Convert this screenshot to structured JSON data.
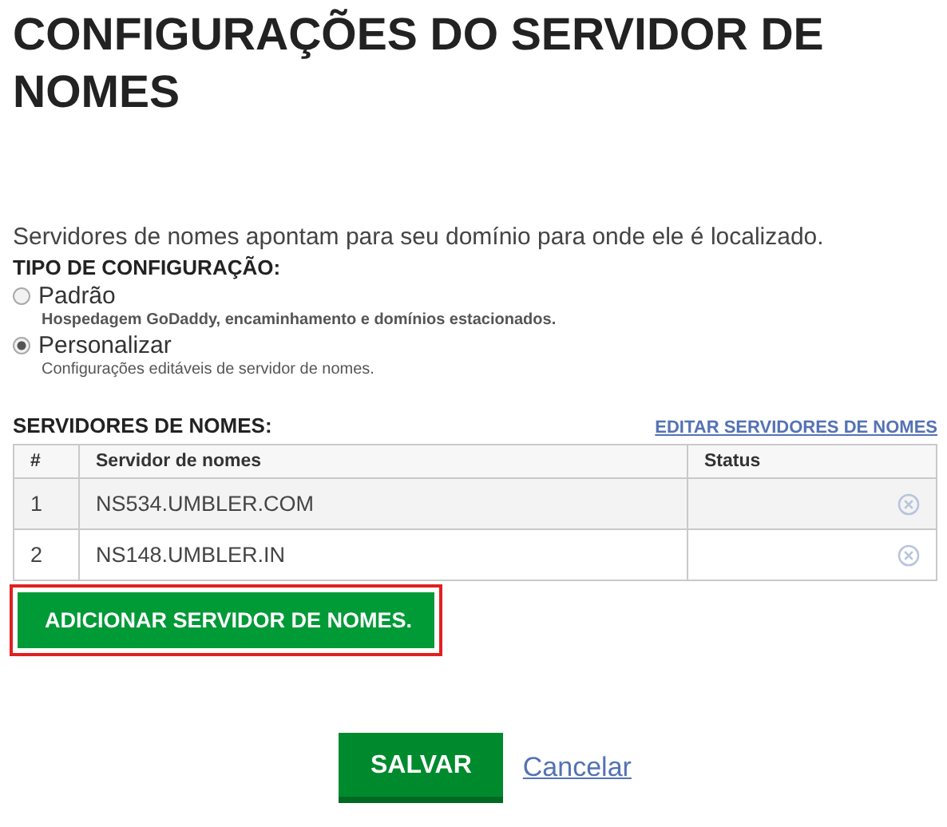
{
  "title": "CONFIGURAÇÕES DO SERVIDOR DE NOMES",
  "intro": "Servidores de nomes apontam para seu domínio para onde ele é localizado.",
  "config_type": {
    "label": "TIPO DE CONFIGURAÇÃO:",
    "options": [
      {
        "label": "Padrão",
        "description": "Hospedagem GoDaddy, encaminhamento e domínios estacionados.",
        "selected": false,
        "bold_description": true
      },
      {
        "label": "Personalizar",
        "description": "Configurações editáveis de servidor de nomes.",
        "selected": true,
        "bold_description": false
      }
    ]
  },
  "nameservers": {
    "label": "SERVIDORES DE NOMES:",
    "edit_link": "EDITAR SERVIDORES DE NOMES",
    "columns": [
      "#",
      "Servidor de nomes",
      "Status"
    ],
    "rows": [
      {
        "index": "1",
        "name": "NS534.UMBLER.COM"
      },
      {
        "index": "2",
        "name": "NS148.UMBLER.IN"
      }
    ],
    "add_button": {
      "label": "ADICIONAR SERVIDOR DE NOMES.",
      "highlighted": true
    }
  },
  "buttons": {
    "save": "SALVAR",
    "cancel": "Cancelar"
  }
}
